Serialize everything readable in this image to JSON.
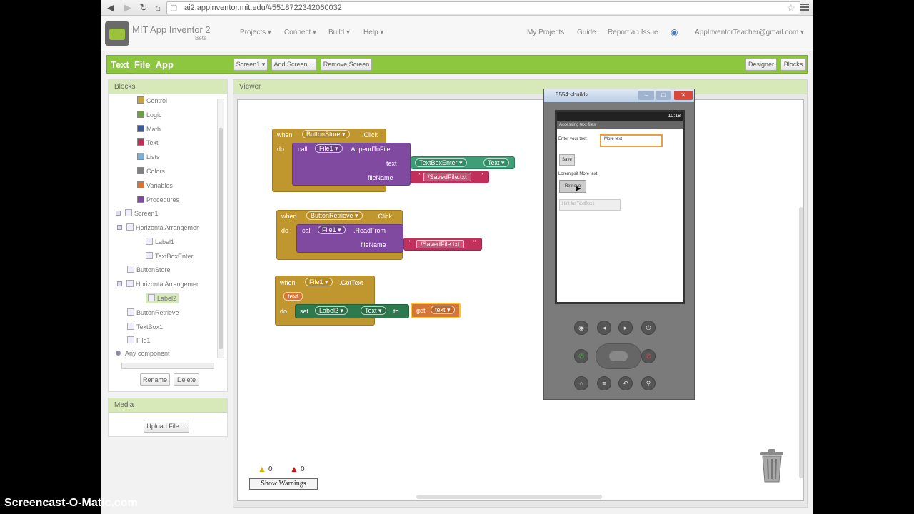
{
  "browser": {
    "url": "ai2.appinventor.mit.edu/#5518722342060032"
  },
  "header": {
    "title": "MIT App Inventor 2",
    "beta": "Beta",
    "menus": [
      "Projects ▾",
      "Connect ▾",
      "Build ▾",
      "Help ▾"
    ],
    "links": [
      "My Projects",
      "Guide",
      "Report an Issue"
    ],
    "account": "AppInventorTeacher@gmail.com ▾"
  },
  "toolbar": {
    "project_name": "Text_File_App",
    "screen_select": "Screen1 ▾",
    "add_screen": "Add Screen ...",
    "remove_screen": "Remove Screen",
    "designer": "Designer",
    "blocks": "Blocks"
  },
  "blocks_panel": {
    "title": "Blocks",
    "builtins": [
      {
        "label": "Control",
        "color": "#c8a338"
      },
      {
        "label": "Logic",
        "color": "#6d9e3f"
      },
      {
        "label": "Math",
        "color": "#3b5c96"
      },
      {
        "label": "Text",
        "color": "#c0305a"
      },
      {
        "label": "Lists",
        "color": "#7ab0d8"
      },
      {
        "label": "Colors",
        "color": "#808080"
      },
      {
        "label": "Variables",
        "color": "#d47638"
      },
      {
        "label": "Procedures",
        "color": "#7b4d9c"
      }
    ],
    "screen": "Screen1",
    "components": [
      {
        "label": "HorizontalArrangemer",
        "indent": 1,
        "toggle": true
      },
      {
        "label": "Label1",
        "indent": 2
      },
      {
        "label": "TextBoxEnter",
        "indent": 2
      },
      {
        "label": "ButtonStore",
        "indent": 1
      },
      {
        "label": "HorizontalArrangemer",
        "indent": 1,
        "toggle": true
      },
      {
        "label": "Label2",
        "indent": 2,
        "selected": true
      },
      {
        "label": "ButtonRetrieve",
        "indent": 1
      },
      {
        "label": "TextBox1",
        "indent": 1
      },
      {
        "label": "File1",
        "indent": 1
      }
    ],
    "any_component": "Any component",
    "rename": "Rename",
    "delete": "Delete"
  },
  "media_panel": {
    "title": "Media",
    "upload": "Upload File ..."
  },
  "viewer": {
    "title": "Viewer",
    "warnings_count": "0",
    "errors_count": "0",
    "show_warnings": "Show Warnings"
  },
  "blocks": {
    "b1": {
      "when": "when",
      "component": "ButtonStore ▾",
      "event": ".Click",
      "do": "do",
      "call": "call",
      "call_comp": "File1 ▾",
      "method": ".AppendToFile",
      "arg1": "text",
      "arg1_comp": "TextBoxEnter ▾",
      "arg1_prop": "Text ▾",
      "arg2": "fileName",
      "arg2_value": "/SavedFile.txt"
    },
    "b2": {
      "when": "when",
      "component": "ButtonRetrieve ▾",
      "event": ".Click",
      "do": "do",
      "call": "call",
      "call_comp": "File1 ▾",
      "method": ".ReadFrom",
      "arg": "fileName",
      "arg_value": "/SavedFile.txt"
    },
    "b3": {
      "when": "when",
      "component": "File1 ▾",
      "event": ".GotText",
      "param": "text",
      "do": "do",
      "set": "set",
      "set_comp": "Label2 ▾",
      "set_prop": "Text ▾",
      "to": "to",
      "get": "get",
      "get_var": "text ▾"
    }
  },
  "emulator": {
    "title": "5554:<build>",
    "clock": "10:18",
    "app_title": "Accessing text files",
    "enter_label": "Enter your text:",
    "enter_value": "More text",
    "save_btn": "Save",
    "label2": "Loremipsit More text.",
    "retrieve_btn": "Retrieve",
    "textbox_hint": "Hint for TextBox1"
  },
  "watermark": "Screencast-O-Matic.com"
}
